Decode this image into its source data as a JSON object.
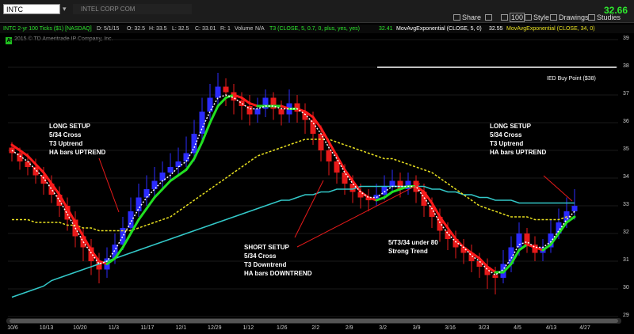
{
  "toolbar": {
    "symbol": "INTC",
    "company": "INTEL CORP COM",
    "share_label": "Share",
    "zoom_value": "100",
    "style_label": "Style",
    "drawings_label": "Drawings",
    "studies_label": "Studies",
    "last_price": "32.66"
  },
  "study_bar": {
    "chart_desc": "INTC 2-yr 100 Ticks ($1) [NASDAQ]",
    "date": "D: 5/1/15",
    "open": "O: 32.5",
    "high": "H: 33.5",
    "low": "L: 32.5",
    "close": "C: 33.01",
    "range": "R: 1",
    "volume": "Volume",
    "volume_val": "N/A",
    "t3_desc": "T3 (CLOSE, 5, 0.7, 0, plus, yes, yes)",
    "t3_val": "32.41",
    "ema5_desc": "MovAvgExponential (CLOSE, 5, 0)",
    "ema5_val": "32.55",
    "ema34_desc": "MovAvgExponential (CLOSE, 34, 0)"
  },
  "copyright": "2015 © TD Ameritrade IP Company, Inc.",
  "badge": "A",
  "annotations": {
    "long_setup_left": "LONG SETUP\n5/34 Cross\nT3 Uptrend\nHA bars UPTREND",
    "short_setup": "SHORT SETUP\n5/34 Cross\nT3 Downtrend\nHA bars DOWNTREND",
    "strong_trend": "5/T3/34 under 80\nStrong Trend",
    "long_setup_right": "LONG SETUP\n5/34 Cross\nT3 Uptrend\nHA bars UPTREND",
    "buy_point": "IED Buy Point ($38)"
  },
  "colors": {
    "background": "#000000",
    "bull_candle": "#2b2bff",
    "bear_candle": "#e81a1a",
    "ema5_dotted": "#ffffff",
    "t3_up": "#22e022",
    "t3_down": "#ff1a1a",
    "ema34_dashed": "#e8e020",
    "long_ma": "#33c8c8",
    "price_up": "#2ee82e"
  },
  "chart_data": {
    "type": "candlestick",
    "ylim": [
      29,
      39
    ],
    "y_ticks": [
      29,
      30,
      31,
      32,
      33,
      34,
      35,
      36,
      37,
      38,
      39
    ],
    "x_ticks": [
      "10/6",
      "10/13",
      "10/20",
      "11/3",
      "11/17",
      "12/1",
      "12/29",
      "1/12",
      "1/26",
      "2/2",
      "2/9",
      "3/2",
      "3/9",
      "3/16",
      "3/23",
      "4/5",
      "4/13",
      "4/27"
    ],
    "buy_point": 38,
    "candles": [
      {
        "o": 35.1,
        "c": 34.9,
        "h": 35.3,
        "l": 34.6
      },
      {
        "o": 34.9,
        "c": 34.6,
        "h": 35.1,
        "l": 34.3
      },
      {
        "o": 34.6,
        "c": 34.4,
        "h": 34.9,
        "l": 34.1
      },
      {
        "o": 34.4,
        "c": 34.1,
        "h": 34.7,
        "l": 33.8
      },
      {
        "o": 34.1,
        "c": 33.8,
        "h": 34.4,
        "l": 33.4
      },
      {
        "o": 33.8,
        "c": 33.4,
        "h": 34.1,
        "l": 33.1
      },
      {
        "o": 33.4,
        "c": 33.0,
        "h": 33.7,
        "l": 32.6
      },
      {
        "o": 33.0,
        "c": 32.5,
        "h": 33.3,
        "l": 32.1
      },
      {
        "o": 32.5,
        "c": 31.9,
        "h": 32.8,
        "l": 31.5
      },
      {
        "o": 31.9,
        "c": 31.5,
        "h": 32.2,
        "l": 31.0
      },
      {
        "o": 31.5,
        "c": 31.0,
        "h": 31.8,
        "l": 30.5
      },
      {
        "o": 31.0,
        "c": 30.7,
        "h": 31.3,
        "l": 30.2
      },
      {
        "o": 30.7,
        "c": 31.1,
        "h": 31.5,
        "l": 30.4
      },
      {
        "o": 31.1,
        "c": 31.6,
        "h": 32.0,
        "l": 30.9
      },
      {
        "o": 31.6,
        "c": 32.2,
        "h": 32.6,
        "l": 31.4
      },
      {
        "o": 32.2,
        "c": 32.8,
        "h": 33.3,
        "l": 32.0
      },
      {
        "o": 32.8,
        "c": 33.3,
        "h": 33.8,
        "l": 32.6
      },
      {
        "o": 33.3,
        "c": 33.6,
        "h": 34.1,
        "l": 33.0
      },
      {
        "o": 33.6,
        "c": 33.9,
        "h": 34.4,
        "l": 33.3
      },
      {
        "o": 33.9,
        "c": 34.2,
        "h": 34.6,
        "l": 33.6
      },
      {
        "o": 34.2,
        "c": 34.4,
        "h": 34.9,
        "l": 33.9
      },
      {
        "o": 34.4,
        "c": 34.6,
        "h": 35.1,
        "l": 34.1
      },
      {
        "o": 34.6,
        "c": 34.9,
        "h": 35.5,
        "l": 34.4
      },
      {
        "o": 34.9,
        "c": 35.6,
        "h": 36.1,
        "l": 34.6
      },
      {
        "o": 35.6,
        "c": 36.4,
        "h": 36.9,
        "l": 35.3
      },
      {
        "o": 36.4,
        "c": 36.9,
        "h": 37.4,
        "l": 36.1
      },
      {
        "o": 36.9,
        "c": 37.3,
        "h": 37.8,
        "l": 36.6
      },
      {
        "o": 37.3,
        "c": 37.1,
        "h": 37.6,
        "l": 36.6
      },
      {
        "o": 37.1,
        "c": 36.8,
        "h": 37.4,
        "l": 36.3
      },
      {
        "o": 36.8,
        "c": 36.6,
        "h": 37.1,
        "l": 36.1
      },
      {
        "o": 36.6,
        "c": 36.3,
        "h": 37.0,
        "l": 35.9
      },
      {
        "o": 36.3,
        "c": 36.5,
        "h": 36.9,
        "l": 36.0
      },
      {
        "o": 36.5,
        "c": 36.9,
        "h": 37.2,
        "l": 36.2
      },
      {
        "o": 36.9,
        "c": 36.5,
        "h": 37.1,
        "l": 36.1
      },
      {
        "o": 36.5,
        "c": 36.3,
        "h": 36.8,
        "l": 35.9
      },
      {
        "o": 36.3,
        "c": 36.7,
        "h": 37.2,
        "l": 36.0
      },
      {
        "o": 36.7,
        "c": 36.4,
        "h": 37.0,
        "l": 36.0
      },
      {
        "o": 36.4,
        "c": 36.1,
        "h": 36.7,
        "l": 35.6
      },
      {
        "o": 36.1,
        "c": 35.6,
        "h": 36.4,
        "l": 35.2
      },
      {
        "o": 35.6,
        "c": 35.0,
        "h": 35.9,
        "l": 34.6
      },
      {
        "o": 35.0,
        "c": 34.6,
        "h": 35.3,
        "l": 34.1
      },
      {
        "o": 34.6,
        "c": 34.2,
        "h": 34.9,
        "l": 33.8
      },
      {
        "o": 34.2,
        "c": 33.8,
        "h": 34.5,
        "l": 33.4
      },
      {
        "o": 33.8,
        "c": 33.5,
        "h": 34.1,
        "l": 33.1
      },
      {
        "o": 33.5,
        "c": 33.3,
        "h": 33.8,
        "l": 32.9
      },
      {
        "o": 33.3,
        "c": 33.2,
        "h": 33.6,
        "l": 32.8
      },
      {
        "o": 33.2,
        "c": 33.4,
        "h": 33.8,
        "l": 33.0
      },
      {
        "o": 33.4,
        "c": 33.7,
        "h": 34.1,
        "l": 33.2
      },
      {
        "o": 33.7,
        "c": 33.9,
        "h": 34.3,
        "l": 33.5
      },
      {
        "o": 33.9,
        "c": 33.6,
        "h": 34.2,
        "l": 33.3
      },
      {
        "o": 33.6,
        "c": 33.9,
        "h": 34.2,
        "l": 33.4
      },
      {
        "o": 33.9,
        "c": 33.5,
        "h": 34.1,
        "l": 33.1
      },
      {
        "o": 33.5,
        "c": 33.0,
        "h": 33.8,
        "l": 32.6
      },
      {
        "o": 33.0,
        "c": 32.6,
        "h": 33.3,
        "l": 32.2
      },
      {
        "o": 32.6,
        "c": 32.1,
        "h": 32.9,
        "l": 31.7
      },
      {
        "o": 32.1,
        "c": 31.8,
        "h": 32.4,
        "l": 31.4
      },
      {
        "o": 31.8,
        "c": 31.5,
        "h": 32.1,
        "l": 31.1
      },
      {
        "o": 31.5,
        "c": 31.3,
        "h": 31.8,
        "l": 30.9
      },
      {
        "o": 31.3,
        "c": 31.0,
        "h": 31.6,
        "l": 30.6
      },
      {
        "o": 31.0,
        "c": 30.8,
        "h": 31.3,
        "l": 30.4
      },
      {
        "o": 30.8,
        "c": 30.5,
        "h": 31.1,
        "l": 30.0
      },
      {
        "o": 30.5,
        "c": 30.4,
        "h": 30.8,
        "l": 29.8
      },
      {
        "o": 30.4,
        "c": 30.9,
        "h": 31.4,
        "l": 30.2
      },
      {
        "o": 30.9,
        "c": 31.5,
        "h": 31.9,
        "l": 30.6
      },
      {
        "o": 31.5,
        "c": 32.0,
        "h": 32.4,
        "l": 31.2
      },
      {
        "o": 32.0,
        "c": 31.6,
        "h": 32.2,
        "l": 31.3
      },
      {
        "o": 31.6,
        "c": 31.3,
        "h": 31.9,
        "l": 31.0
      },
      {
        "o": 31.3,
        "c": 31.5,
        "h": 31.8,
        "l": 31.0
      },
      {
        "o": 31.5,
        "c": 32.0,
        "h": 32.5,
        "l": 31.3
      },
      {
        "o": 32.0,
        "c": 32.4,
        "h": 32.9,
        "l": 31.8
      },
      {
        "o": 32.4,
        "c": 32.8,
        "h": 33.3,
        "l": 32.2
      },
      {
        "o": 32.8,
        "c": 33.0,
        "h": 33.6,
        "l": 32.5
      }
    ],
    "ema5": [
      35.0,
      34.8,
      34.6,
      34.3,
      34.0,
      33.6,
      33.2,
      32.7,
      32.2,
      31.7,
      31.3,
      30.9,
      31.0,
      31.4,
      31.9,
      32.4,
      32.9,
      33.3,
      33.6,
      33.9,
      34.1,
      34.4,
      34.6,
      35.1,
      35.8,
      36.4,
      36.9,
      37.0,
      36.9,
      36.7,
      36.5,
      36.5,
      36.6,
      36.6,
      36.5,
      36.5,
      36.5,
      36.3,
      36.0,
      35.6,
      35.1,
      34.7,
      34.2,
      33.8,
      33.5,
      33.3,
      33.3,
      33.5,
      33.7,
      33.7,
      33.7,
      33.7,
      33.3,
      32.9,
      32.4,
      32.0,
      31.7,
      31.5,
      31.2,
      31.0,
      30.7,
      30.5,
      30.7,
      31.1,
      31.6,
      31.7,
      31.5,
      31.5,
      31.7,
      32.1,
      32.5,
      32.8
    ],
    "t3": [
      35.2,
      35.0,
      34.8,
      34.5,
      34.2,
      33.8,
      33.4,
      32.9,
      32.4,
      31.9,
      31.4,
      31.0,
      30.9,
      31.1,
      31.5,
      32.0,
      32.5,
      32.9,
      33.3,
      33.6,
      33.9,
      34.1,
      34.3,
      34.7,
      35.3,
      36.0,
      36.6,
      36.9,
      37.0,
      36.9,
      36.7,
      36.6,
      36.6,
      36.6,
      36.6,
      36.5,
      36.5,
      36.4,
      36.2,
      35.8,
      35.3,
      34.8,
      34.3,
      33.9,
      33.5,
      33.3,
      33.2,
      33.3,
      33.5,
      33.6,
      33.7,
      33.7,
      33.5,
      33.1,
      32.6,
      32.2,
      31.8,
      31.5,
      31.3,
      31.1,
      30.8,
      30.6,
      30.6,
      30.9,
      31.4,
      31.6,
      31.5,
      31.4,
      31.6,
      32.0,
      32.4,
      32.6
    ],
    "ema34": [
      32.5,
      32.5,
      32.5,
      32.4,
      32.4,
      32.4,
      32.4,
      32.3,
      32.3,
      32.2,
      32.2,
      32.1,
      32.1,
      32.1,
      32.1,
      32.1,
      32.2,
      32.3,
      32.4,
      32.5,
      32.6,
      32.8,
      33.0,
      33.2,
      33.4,
      33.6,
      33.8,
      34.0,
      34.2,
      34.4,
      34.6,
      34.8,
      34.9,
      35.0,
      35.1,
      35.2,
      35.3,
      35.4,
      35.4,
      35.4,
      35.4,
      35.3,
      35.2,
      35.1,
      35.0,
      34.9,
      34.8,
      34.7,
      34.7,
      34.6,
      34.5,
      34.4,
      34.3,
      34.2,
      34.0,
      33.8,
      33.6,
      33.4,
      33.2,
      33.0,
      32.9,
      32.8,
      32.7,
      32.6,
      32.6,
      32.6,
      32.5,
      32.5,
      32.5,
      32.5,
      32.6,
      32.6
    ],
    "long_ma": [
      29.7,
      29.8,
      29.9,
      30.0,
      30.1,
      30.3,
      30.4,
      30.5,
      30.6,
      30.7,
      30.8,
      30.9,
      31.0,
      31.1,
      31.2,
      31.3,
      31.4,
      31.5,
      31.6,
      31.7,
      31.8,
      31.9,
      32.0,
      32.1,
      32.2,
      32.3,
      32.4,
      32.5,
      32.6,
      32.7,
      32.8,
      32.9,
      33.0,
      33.1,
      33.2,
      33.2,
      33.3,
      33.4,
      33.4,
      33.5,
      33.5,
      33.6,
      33.6,
      33.6,
      33.7,
      33.7,
      33.7,
      33.7,
      33.7,
      33.7,
      33.7,
      33.7,
      33.7,
      33.6,
      33.6,
      33.5,
      33.5,
      33.4,
      33.4,
      33.3,
      33.3,
      33.2,
      33.2,
      33.2,
      33.1,
      33.1,
      33.1,
      33.1,
      33.1,
      33.1,
      33.1,
      33.1
    ]
  }
}
